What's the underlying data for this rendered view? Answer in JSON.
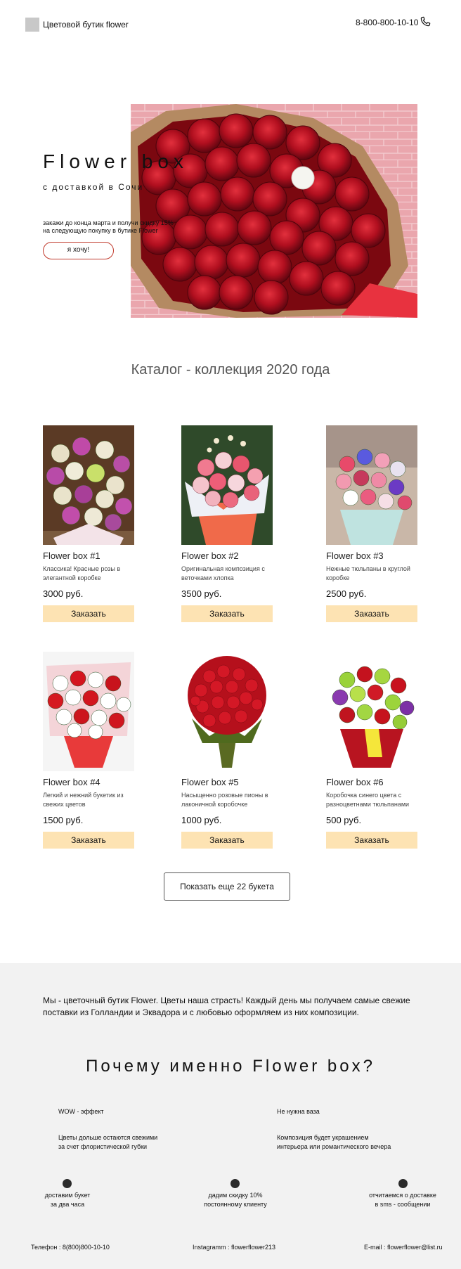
{
  "header": {
    "brand": "Цветовой бутик flower",
    "phone": "8-800-800-10-10"
  },
  "hero": {
    "title": "Flower box",
    "subtitle": "с доставкой в Сочи",
    "promo_line1": "закажи до конца марта и получи скидку 15%",
    "promo_line2": "на следующую покупку в бутике Flower",
    "button": "я хочу!"
  },
  "catalog": {
    "title": "Каталог  - коллекция 2020 года",
    "order_label": "Заказать",
    "items": [
      {
        "name": "Flower box #1",
        "desc": "Классика! Красные розы в элегантной коробке",
        "price": "3000 руб."
      },
      {
        "name": "Flower box #2",
        "desc": "Оригинальная композиция с веточками хлопка",
        "price": "3500 руб."
      },
      {
        "name": "Flower box #3",
        "desc": "Нежные тюльпаны в круглой коробке",
        "price": "2500 руб."
      },
      {
        "name": "Flower box #4",
        "desc": "Легкий и нежний букетик из свежих цветов",
        "price": "1500 руб."
      },
      {
        "name": "Flower box #5",
        "desc": "Насыщенно розовые пионы в лаконичной коробочке",
        "price": "1000 руб."
      },
      {
        "name": "Flower box #6",
        "desc": "Коробочка синего цвета с разноцветнами тюльпанами",
        "price": "500 руб."
      }
    ],
    "more_button": "Показать еще 22 букета"
  },
  "about": {
    "text": "Мы - цветочный бутик Flower. Цветы наша страсть! Каждый день мы получаем самые свежие поставки из Голландии и Эквадора и с любовью оформляем из них композиции."
  },
  "why": {
    "title": "Почему именно Flower box?",
    "features": [
      {
        "title": "WOW - эффект",
        "text_line1": "Цветы дольше остаются свежими",
        "text_line2": "за счет флористической губки"
      },
      {
        "title": "Не нужна ваза",
        "text_line1": "Композиция будет украшением",
        "text_line2": "интерьера или романтического вечера"
      }
    ],
    "benefits": [
      {
        "line1": "доставим букет",
        "line2": "за два часа"
      },
      {
        "line1": "дадим скидку 10%",
        "line2": "постоянному клиенту"
      },
      {
        "line1": "отчитаемся о доставке",
        "line2": "в sms - сообщении"
      }
    ]
  },
  "footer": {
    "phone": "Телефон : 8(800)800-10-10",
    "instagram": "Instagramm : flowerflower213",
    "email": "E-mail : flowerflower@list.ru"
  },
  "colors": {
    "accent_button": "#fde3b3",
    "hero_button_border": "#c0392b",
    "section_gray": "#f2f2f2"
  },
  "icons": [
    "logo-placeholder",
    "phone-icon"
  ]
}
